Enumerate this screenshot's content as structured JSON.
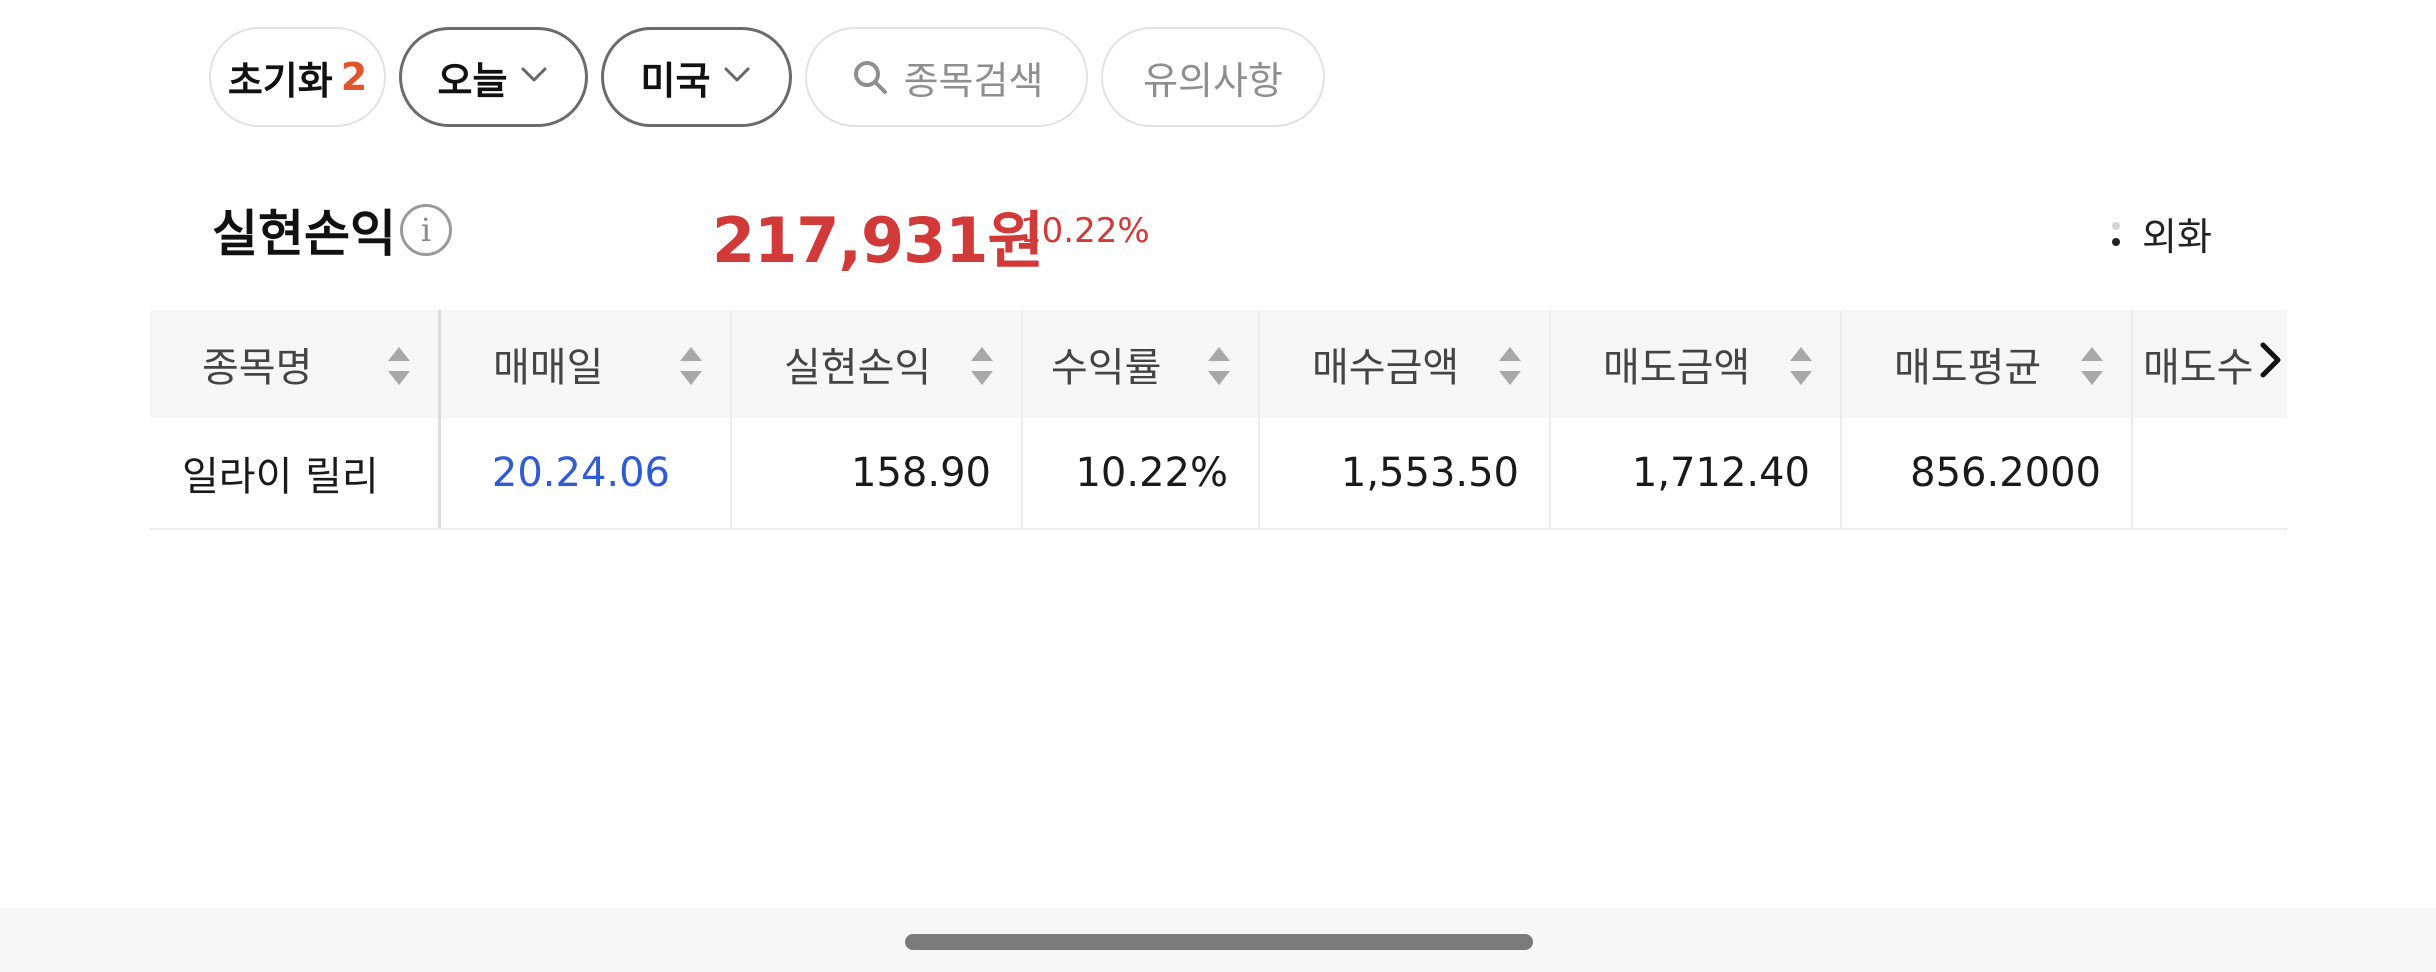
{
  "filters": {
    "reset_label": "초기화",
    "reset_count": "2",
    "period_label": "오늘",
    "market_label": "미국",
    "search_placeholder": "종목검색",
    "notice_label": "유의사항"
  },
  "summary": {
    "label": "실현손익",
    "info_icon": "i",
    "amount": "217,931원",
    "rate": "10.22%",
    "currency_toggle_label": "외화",
    "amount_color": "#d23a3a"
  },
  "table": {
    "columns": [
      "종목명",
      "매매일",
      "실현손익",
      "수익률",
      "매수금액",
      "매도금액",
      "매도평균",
      "매도수"
    ],
    "rows": [
      {
        "name": "일라이 릴리",
        "trade_date": "20.24.06",
        "realized_pl": "158.90",
        "return_rate": "10.22%",
        "buy_amount": "1,553.50",
        "sell_amount": "1,712.40",
        "sell_avg": "856.2000",
        "sell_qty": ""
      }
    ]
  },
  "icons": {
    "chevron": "chevron-down-icon",
    "search": "search-icon",
    "sort": "sort-icon",
    "scroll": "chevron-right-icon"
  }
}
